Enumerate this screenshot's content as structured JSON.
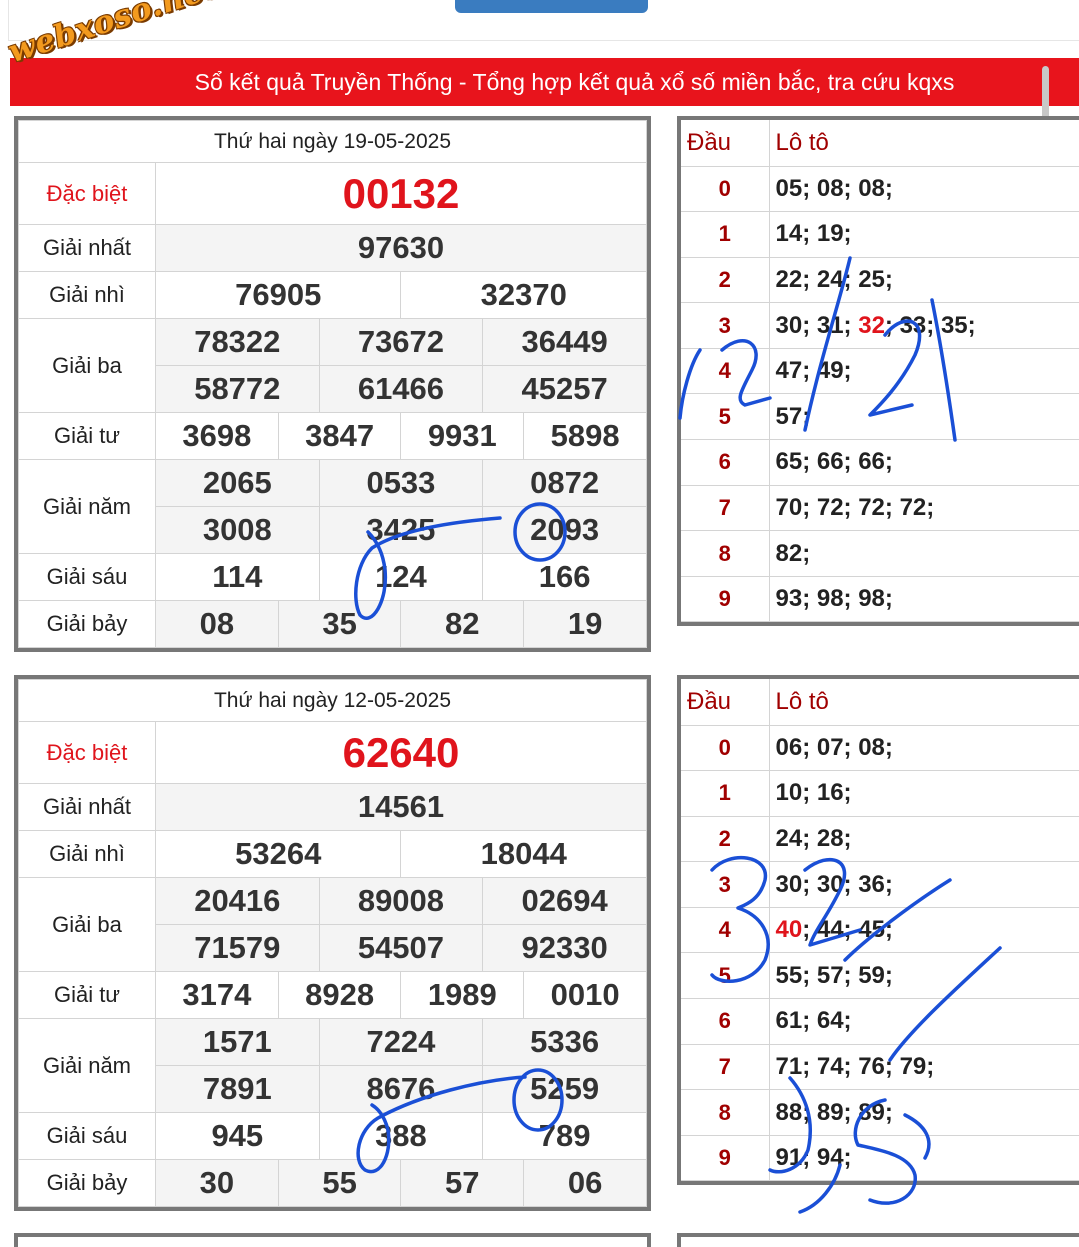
{
  "site": {
    "logo_text": "webxoso.net",
    "banner": "Sổ kết quả Truyền Thống - Tổng hợp kết quả xổ số miền bắc, tra cứu kqxs"
  },
  "labels": {
    "special": "Đặc biệt",
    "first": "Giải nhất",
    "second": "Giải nhì",
    "third": "Giải ba",
    "fourth": "Giải tư",
    "fifth": "Giải năm",
    "sixth": "Giải sáu",
    "seventh": "Giải bảy",
    "loto_head": "Đầu",
    "loto_title": "Lô tô"
  },
  "draws": [
    {
      "date": "Thứ hai ngày 19-05-2025",
      "special": "00132",
      "first": "97630",
      "second": [
        "76905",
        "32370"
      ],
      "third": [
        "78322",
        "73672",
        "36449",
        "58772",
        "61466",
        "45257"
      ],
      "fourth": [
        "3698",
        "3847",
        "9931",
        "5898"
      ],
      "fifth": [
        "2065",
        "0533",
        "0872",
        "3008",
        "3425",
        "2093"
      ],
      "sixth": [
        "114",
        "124",
        "166"
      ],
      "seventh": [
        "08",
        "35",
        "82",
        "19"
      ],
      "loto": [
        {
          "head": "0",
          "text": "05; 08; 08;"
        },
        {
          "head": "1",
          "text": "14; 19;"
        },
        {
          "head": "2",
          "text": "22; 24; 25;"
        },
        {
          "head": "3",
          "text": "30; 31; ",
          "hl": "32",
          "rest": "; 33; 35;"
        },
        {
          "head": "4",
          "text": "47; 49;"
        },
        {
          "head": "5",
          "text": "57;"
        },
        {
          "head": "6",
          "text": "65; 66; 66;"
        },
        {
          "head": "7",
          "text": "70; 72; 72; 72;"
        },
        {
          "head": "8",
          "text": "82;"
        },
        {
          "head": "9",
          "text": "93; 98; 98;"
        }
      ]
    },
    {
      "date": "Thứ hai ngày 12-05-2025",
      "special": "62640",
      "first": "14561",
      "second": [
        "53264",
        "18044"
      ],
      "third": [
        "20416",
        "89008",
        "02694",
        "71579",
        "54507",
        "92330"
      ],
      "fourth": [
        "3174",
        "8928",
        "1989",
        "0010"
      ],
      "fifth": [
        "1571",
        "7224",
        "5336",
        "7891",
        "8676",
        "5259"
      ],
      "sixth": [
        "945",
        "388",
        "789"
      ],
      "seventh": [
        "30",
        "55",
        "57",
        "06"
      ],
      "loto": [
        {
          "head": "0",
          "text": "06; 07; 08;"
        },
        {
          "head": "1",
          "text": "10; 16;"
        },
        {
          "head": "2",
          "text": "24; 28;"
        },
        {
          "head": "3",
          "text": "30; 30; 36;"
        },
        {
          "head": "4",
          "hl": "40",
          "rest": "; 44; 45;"
        },
        {
          "head": "5",
          "text": "55; 57; 59;"
        },
        {
          "head": "6",
          "text": "61; 64;"
        },
        {
          "head": "7",
          "text": "71; 74; 76; 79;"
        },
        {
          "head": "8",
          "text": "88; 89; 89;"
        },
        {
          "head": "9",
          "text": "91; 94;"
        }
      ]
    }
  ],
  "colors": {
    "banner": "#e8141c",
    "special": "#e0141c",
    "loto_head": "#a00000",
    "ink": "#1a4fd6",
    "logo": "#f39a1e"
  }
}
